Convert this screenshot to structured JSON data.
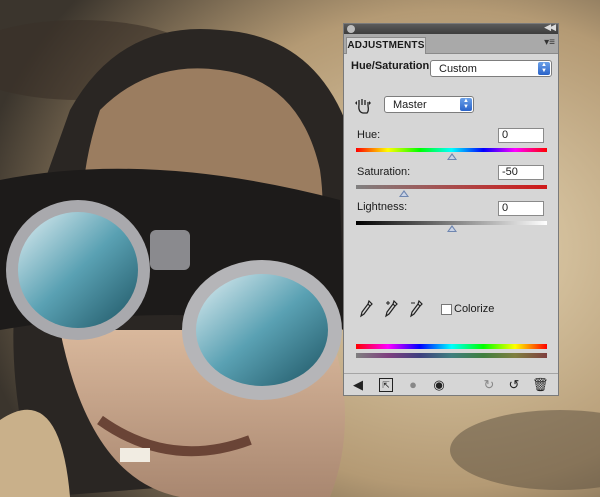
{
  "panel": {
    "tab_label": "ADJUSTMENTS",
    "adjustment_title": "Hue/Saturation",
    "preset_value": "Custom",
    "channel_value": "Master",
    "hue": {
      "label": "Hue:",
      "value": "0",
      "position": 0.5
    },
    "saturation": {
      "label": "Saturation:",
      "value": "-50",
      "position": 0.25
    },
    "lightness": {
      "label": "Lightness:",
      "value": "0",
      "position": 0.5
    },
    "colorize_label": "Colorize",
    "colorize_checked": false
  },
  "colors": {
    "panel_bg": "#d6d6d6",
    "popup_accent": "#2a63c9",
    "titlebar": "#3c3c3c"
  },
  "icons": {
    "panel_menu": "panel-menu-icon",
    "collapse": "collapse-arrows-icon",
    "targeted_adjust": "hand-adjust-icon",
    "eyedropper": "eyedropper-icon",
    "eyedropper_add": "eyedropper-plus-icon",
    "eyedropper_subtract": "eyedropper-minus-icon",
    "footer": [
      "back-arrow-icon",
      "clip-to-layer-icon",
      "mask-icon",
      "visibility-eye-icon",
      "view-previous-icon",
      "reset-icon",
      "trash-icon"
    ]
  }
}
